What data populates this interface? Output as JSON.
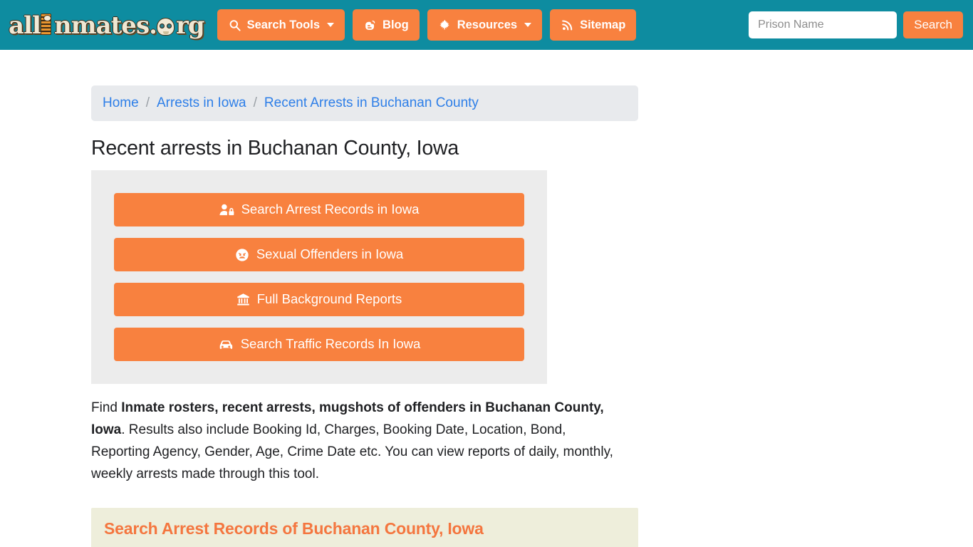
{
  "header": {
    "logo": {
      "text": "allInmates.org",
      "parts": {
        "a": "a",
        "ll": "ll",
        "i": "I",
        "nmates": "nmates",
        "dot": ".",
        "o": "o",
        "rg": "rg"
      }
    },
    "nav": [
      {
        "label": "Search Tools",
        "icon": "search-icon",
        "caret": true
      },
      {
        "label": "Blog",
        "icon": "blogger-icon",
        "caret": false
      },
      {
        "label": "Resources",
        "icon": "leaf-icon",
        "caret": true
      },
      {
        "label": "Sitemap",
        "icon": "rss-icon",
        "caret": false
      }
    ],
    "search": {
      "placeholder": "Prison Name",
      "value": "",
      "button_label": "Search"
    }
  },
  "breadcrumb": [
    {
      "label": "Home"
    },
    {
      "label": "Arrests in Iowa"
    },
    {
      "label": "Recent Arrests in Buchanan County"
    }
  ],
  "breadcrumb_separator": "/",
  "main": {
    "title": "Recent arrests in Buchanan County, Iowa",
    "action_buttons": [
      {
        "label": "Search Arrest Records in Iowa",
        "icon": "user-lock-icon"
      },
      {
        "label": "Sexual Offenders in Iowa",
        "icon": "angry-face-icon"
      },
      {
        "label": "Full Background Reports",
        "icon": "landmark-icon"
      },
      {
        "label": "Search Traffic Records In Iowa",
        "icon": "car-icon"
      }
    ],
    "paragraph": {
      "prefix": "Find ",
      "bold": "Inmate rosters, recent arrests, mugshots of offenders in Buchanan County, Iowa",
      "suffix": ". Results also include Booking Id, Charges, Booking Date, Location, Bond, Reporting Agency, Gender, Age, Crime Date etc. You can view reports of daily, monthly, weekly arrests made through this tool."
    },
    "section_heading": "Search Arrest Records of Buchanan County, Iowa"
  },
  "colors": {
    "header_teal": "#0e8ca0",
    "accent_orange": "#f8813f",
    "panel_gray": "#ececec",
    "breadcrumb_bg": "#e8eaed",
    "breadcrumb_link": "#2e7fe8",
    "section_bg": "#eeeedb",
    "section_text": "#f4763f"
  }
}
